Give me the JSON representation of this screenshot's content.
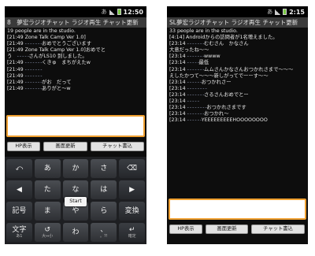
{
  "left": {
    "status": {
      "clock": "12:50"
    },
    "title": "8　夢宏ラジオチャット ラジオ再生 チャット更新",
    "people": "19 people are in the studio.",
    "chat_lines": [
      {
        "prefix": "[21:49 Zone Talk Camp Ver 1.0]",
        "masked": "",
        "text": ""
      },
      {
        "prefix": "[21:49 ",
        "masked": "- - - - - - -",
        "text": "おめでとうございます"
      },
      {
        "prefix": "[21:49 Zone Talk Camp Ver 1.0]おめでと",
        "masked": "",
        "text": ""
      },
      {
        "prefix": "う　",
        "masked": "- - - - -",
        "text": "さんがLS10 到しました。"
      },
      {
        "prefix": "[21:49 ",
        "masked": "- - - - - - -",
        "text": "くきゅ　まちがえたw"
      },
      {
        "prefix": "[21:49 ",
        "masked": "- - - - - - -",
        "text": ""
      },
      {
        "prefix": "[21:49 ",
        "masked": "- - - - - - -",
        "text": ""
      },
      {
        "prefix": "[21:49 ",
        "masked": "- - - - - - -",
        "text": "がお　だって"
      },
      {
        "prefix": "[21:49 ",
        "masked": "- - - - - - -",
        "text": "ありがと〜w"
      }
    ],
    "buttons": {
      "hp": "HP表示",
      "refresh": "画面更新",
      "send": "チャット書込"
    },
    "keyboard": {
      "keys": [
        {
          "main": "⤺",
          "sub": "",
          "icon": "undo-icon"
        },
        {
          "main": "あ",
          "sub": "",
          "icon": ""
        },
        {
          "main": "か",
          "sub": "",
          "icon": ""
        },
        {
          "main": "さ",
          "sub": "",
          "icon": ""
        },
        {
          "main": "⌫",
          "sub": "",
          "icon": "delete-icon"
        },
        {
          "main": "◀",
          "sub": "",
          "icon": "cursor-left-icon"
        },
        {
          "main": "た",
          "sub": "",
          "icon": ""
        },
        {
          "main": "な",
          "sub": "",
          "icon": ""
        },
        {
          "main": "は",
          "sub": "",
          "icon": ""
        },
        {
          "main": "▶",
          "sub": "",
          "icon": "cursor-right-icon"
        },
        {
          "main": "記号",
          "sub": "",
          "icon": ""
        },
        {
          "main": "ま",
          "sub": "",
          "icon": ""
        },
        {
          "main": "や",
          "sub": "",
          "icon": ""
        },
        {
          "main": "ら",
          "sub": "",
          "icon": ""
        },
        {
          "main": "変換",
          "sub": "",
          "icon": ""
        },
        {
          "main": "文字",
          "sub": "あ1",
          "icon": ""
        },
        {
          "main": "↺",
          "sub": "大⇔小",
          "icon": ""
        },
        {
          "main": "わ",
          "sub": "",
          "icon": ""
        },
        {
          "main": "、",
          "sub": "。?!",
          "icon": ""
        },
        {
          "main": "↵",
          "sub": "確定",
          "icon": "enter-icon"
        }
      ],
      "popup": "Start"
    }
  },
  "right": {
    "status": {
      "clock": "2:15"
    },
    "title": "SL夢宏ラジオチャット ラジオ再生 チャット更新",
    "people": "33 people are in the studio.",
    "chat_lines": [
      {
        "prefix": "[4:14] Androidからの訪問者が1名増えました。",
        "masked": "",
        "text": ""
      },
      {
        "prefix": "[23:14 ",
        "masked": "- - - - - - -",
        "text": "むむさん　かなさん"
      },
      {
        "prefix": "大意だったね〜〜",
        "masked": "",
        "text": ""
      },
      {
        "prefix": "[23:14 ",
        "masked": "- - - - - - -",
        "text": "wwww"
      },
      {
        "prefix": "[23:14 ",
        "masked": "- - - - -",
        "text": "最低"
      },
      {
        "prefix": "[23:14 ",
        "masked": "- - - - - - -",
        "text": "ムムさんかなさんおつかれさまで〜〜〜　"
      },
      {
        "prefix": "えしたかつて〜〜〜新しがってでーーす〜〜　",
        "masked": "",
        "text": ""
      },
      {
        "prefix": "[23:14 ",
        "masked": "- - - - - -",
        "text": "おつかれさー"
      },
      {
        "prefix": "[23:14 ",
        "masked": "- - - - - - - -",
        "text": ""
      },
      {
        "prefix": "[23:14 ",
        "masked": "- - - - - - -",
        "text": "さるさんおめでとー"
      },
      {
        "prefix": "[23:14 ",
        "masked": "- - - - -",
        "text": ""
      },
      {
        "prefix": "[23:14 ",
        "masked": "- - - - - - - -",
        "text": "おつかれさまです"
      },
      {
        "prefix": "[23:14 ",
        "masked": "- - - - - - -",
        "text": "おつかれ〜"
      },
      {
        "prefix": "[23:14 ",
        "masked": "- - - - - -",
        "text": "YEEEEEEEEEHOOOOOOOO"
      }
    ],
    "buttons": {
      "hp": "HP表示",
      "refresh": "画面更新",
      "send": "チャット書込"
    }
  },
  "colors": {
    "input_border": "#f0a030",
    "title_bg": "#3a3a3a",
    "screen_bg": "#0d0d0d"
  }
}
